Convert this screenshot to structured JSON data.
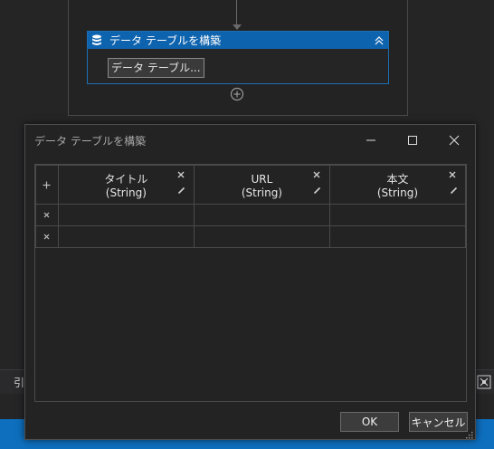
{
  "designer": {
    "activity": {
      "title": "データ テーブルを構築",
      "button_label": "データ テーブル..."
    }
  },
  "background": {
    "props_char": "引"
  },
  "dialog": {
    "title": "データ テーブルを構築",
    "columns": [
      {
        "name": "タイトル",
        "type": "(String)"
      },
      {
        "name": "URL",
        "type": "(String)"
      },
      {
        "name": "本文",
        "type": "(String)"
      }
    ],
    "rows": [
      [
        "",
        "",
        ""
      ],
      [
        "",
        "",
        ""
      ]
    ],
    "ok_label": "OK",
    "cancel_label": "キャンセル"
  },
  "colors": {
    "accent": "#0e63ae",
    "status_bar": "#0e6fbe"
  },
  "icons": [
    "database-icon",
    "collapse-icon",
    "add-circle-icon",
    "minimize-icon",
    "maximize-icon",
    "close-icon",
    "plus-icon",
    "delete-icon",
    "edit-icon",
    "resize-grip-icon"
  ]
}
